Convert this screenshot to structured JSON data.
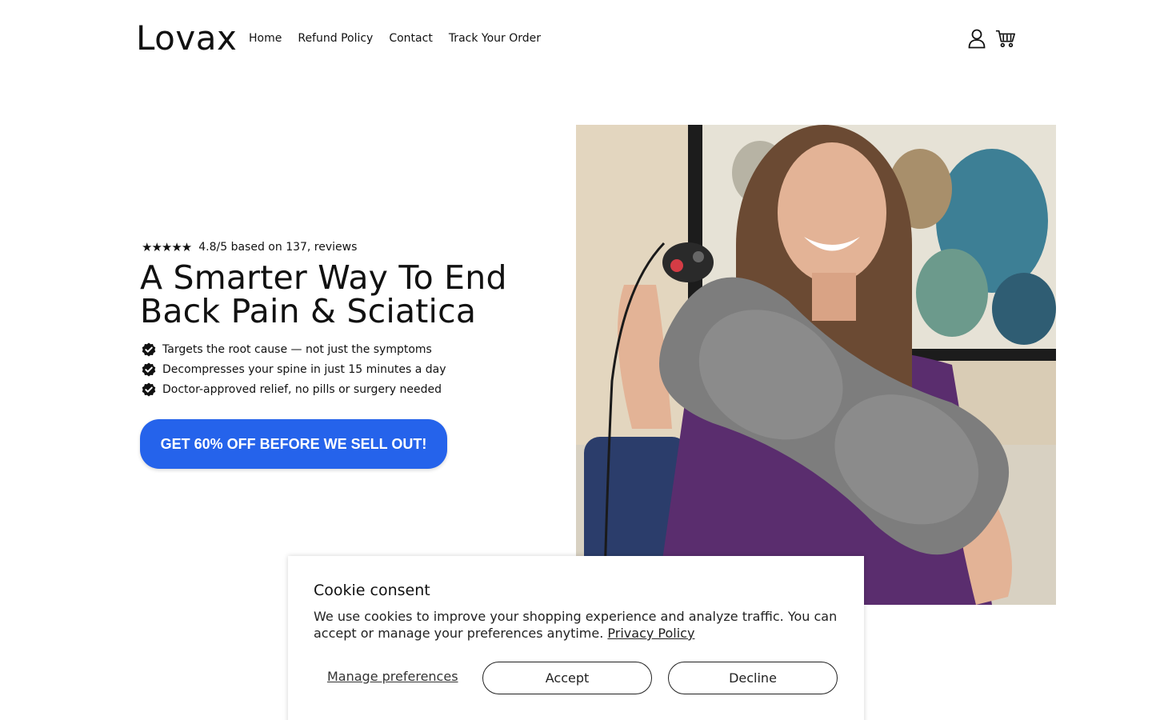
{
  "header": {
    "logo": "Lovax",
    "nav": [
      "Home",
      "Refund Policy",
      "Contact",
      "Track Your Order"
    ],
    "icons": [
      "account-icon",
      "cart-icon"
    ]
  },
  "hero": {
    "stars": "★★★★★",
    "rating_text": "4.8/5 based on 137, reviews",
    "headline": "A Smarter Way To End Back Pain & Sciatica",
    "benefits": [
      "Targets the root cause — not just the symptoms",
      "Decompresses your spine in just 15 minutes a day",
      "Doctor-approved relief, no pills or surgery needed"
    ],
    "cta": "GET 60% OFF BEFORE WE SELL OUT!",
    "cta_color": "#2563eb"
  },
  "cookie": {
    "title": "Cookie consent",
    "text": "We use cookies to improve your shopping experience and analyze traffic. You can accept or manage your preferences anytime.",
    "privacy_link": "Privacy Policy",
    "manage": "Manage preferences",
    "accept": "Accept",
    "decline": "Decline"
  }
}
